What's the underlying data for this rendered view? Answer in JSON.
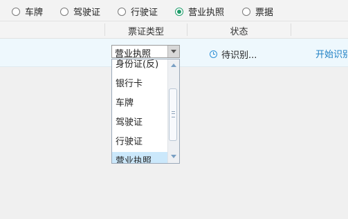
{
  "radio_options": [
    {
      "label": "车牌",
      "checked": false
    },
    {
      "label": "驾驶证",
      "checked": false
    },
    {
      "label": "行驶证",
      "checked": false
    },
    {
      "label": "营业执照",
      "checked": true
    },
    {
      "label": "票据",
      "checked": false
    }
  ],
  "table": {
    "headers": [
      "票证类型",
      "状态"
    ],
    "row": {
      "ticket_type": "营业执照",
      "status": "待识别...",
      "action": "开始识别"
    }
  },
  "dropdown": {
    "items": [
      "身份证(反)",
      "银行卡",
      "车牌",
      "驾驶证",
      "行驶证",
      "营业执照"
    ],
    "selected": "营业执照"
  },
  "colors": {
    "accent": "#1f9c6a",
    "link": "#1d7fc4",
    "row_highlight": "#eef8fd",
    "selected_item": "#cbe8fb"
  }
}
